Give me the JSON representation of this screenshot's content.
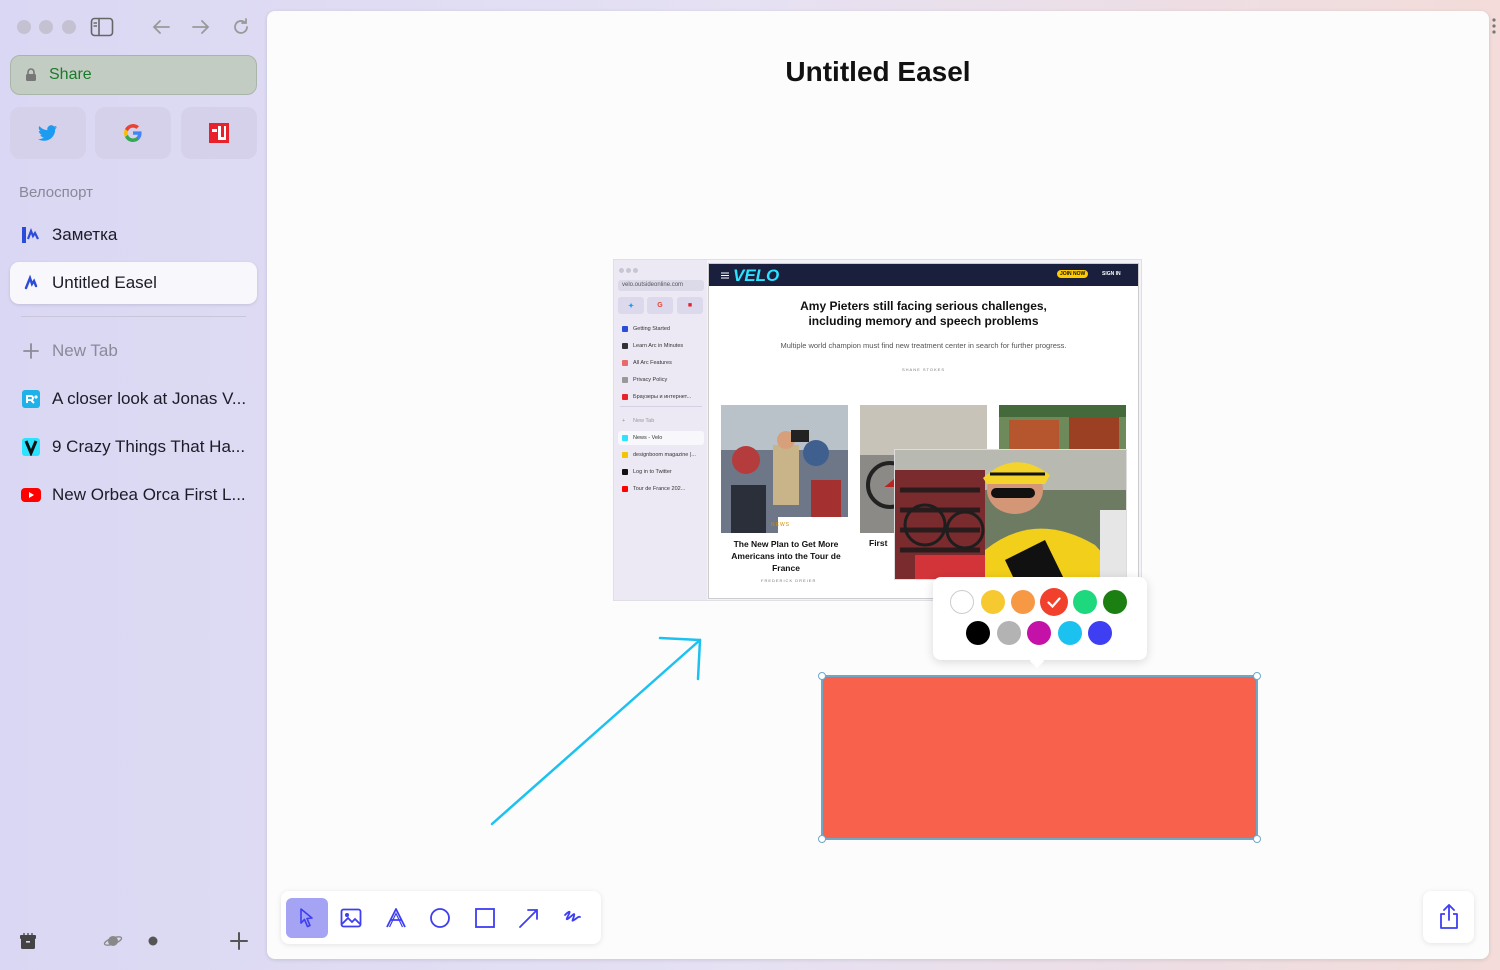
{
  "sidebar": {
    "share_label": "Share",
    "pinned": [
      {
        "name": "twitter-icon",
        "color": "#1d9bf0"
      },
      {
        "name": "google-icon",
        "color": "#4285f4"
      },
      {
        "name": "app-red-icon",
        "color": "#e8212a"
      }
    ],
    "section_label": "Велоспорт",
    "folder_tabs": [
      {
        "label": "Заметка",
        "icon": "easel-note-icon"
      },
      {
        "label": "Untitled Easel",
        "icon": "easel-icon",
        "active": true
      }
    ],
    "new_tab_label": "New Tab",
    "tabs": [
      {
        "label": "A closer look at Jonas V...",
        "icon": "site-r-icon",
        "color": "#1fb2e8"
      },
      {
        "label": "9 Crazy Things That Ha...",
        "icon": "velo-v-icon",
        "color": "#2be3ff"
      },
      {
        "label": "New Orbea Orca First L...",
        "icon": "youtube-icon",
        "color": "#ff0000"
      }
    ]
  },
  "easel": {
    "title": "Untitled Easel"
  },
  "screenshot": {
    "url": "velo.outsideonline.com",
    "sidebar_items": [
      "Getting Started",
      "Learn Arc in Minutes",
      "All Arc Features",
      "Privacy Policy",
      "Браузеры и интернет..."
    ],
    "new_tab": "New Tab",
    "tabs": [
      "News - Velo",
      "designboom magazine |...",
      "Log in to Twitter",
      "Tour de France 202..."
    ],
    "logo": "VELO",
    "join": "JOIN NOW",
    "sign_in": "SIGN IN",
    "headline_1": "Amy Pieters still facing serious challenges,",
    "headline_2": "including memory and speech problems",
    "subline": "Multiple world champion must find new treatment center in search for further progress.",
    "byline": "SHANE STOKES",
    "card_tag": "NEWS",
    "card_title": "The New Plan to Get More Americans into the Tour de France",
    "card_author": "FREDERICK DREIER",
    "card2_title": "First"
  },
  "colors": {
    "swatches_row1": [
      "#ffffff",
      "#f7c931",
      "#f79845",
      "#f1412d",
      "#1ed87e",
      "#1b7f12"
    ],
    "swatches_row2": [
      "#000000",
      "#b3b3b3",
      "#c412a8",
      "#1cc2ef",
      "#3e3ef2"
    ],
    "selected": "#f1412d",
    "rect_fill": "#f8614b",
    "arrow": "#1cc2ef",
    "accent": "#a5a3f4"
  },
  "toolbar": {
    "tools": [
      "select-tool",
      "image-tool",
      "text-tool",
      "circle-tool",
      "rectangle-tool",
      "arrow-tool",
      "pen-tool"
    ],
    "active": "select-tool"
  }
}
